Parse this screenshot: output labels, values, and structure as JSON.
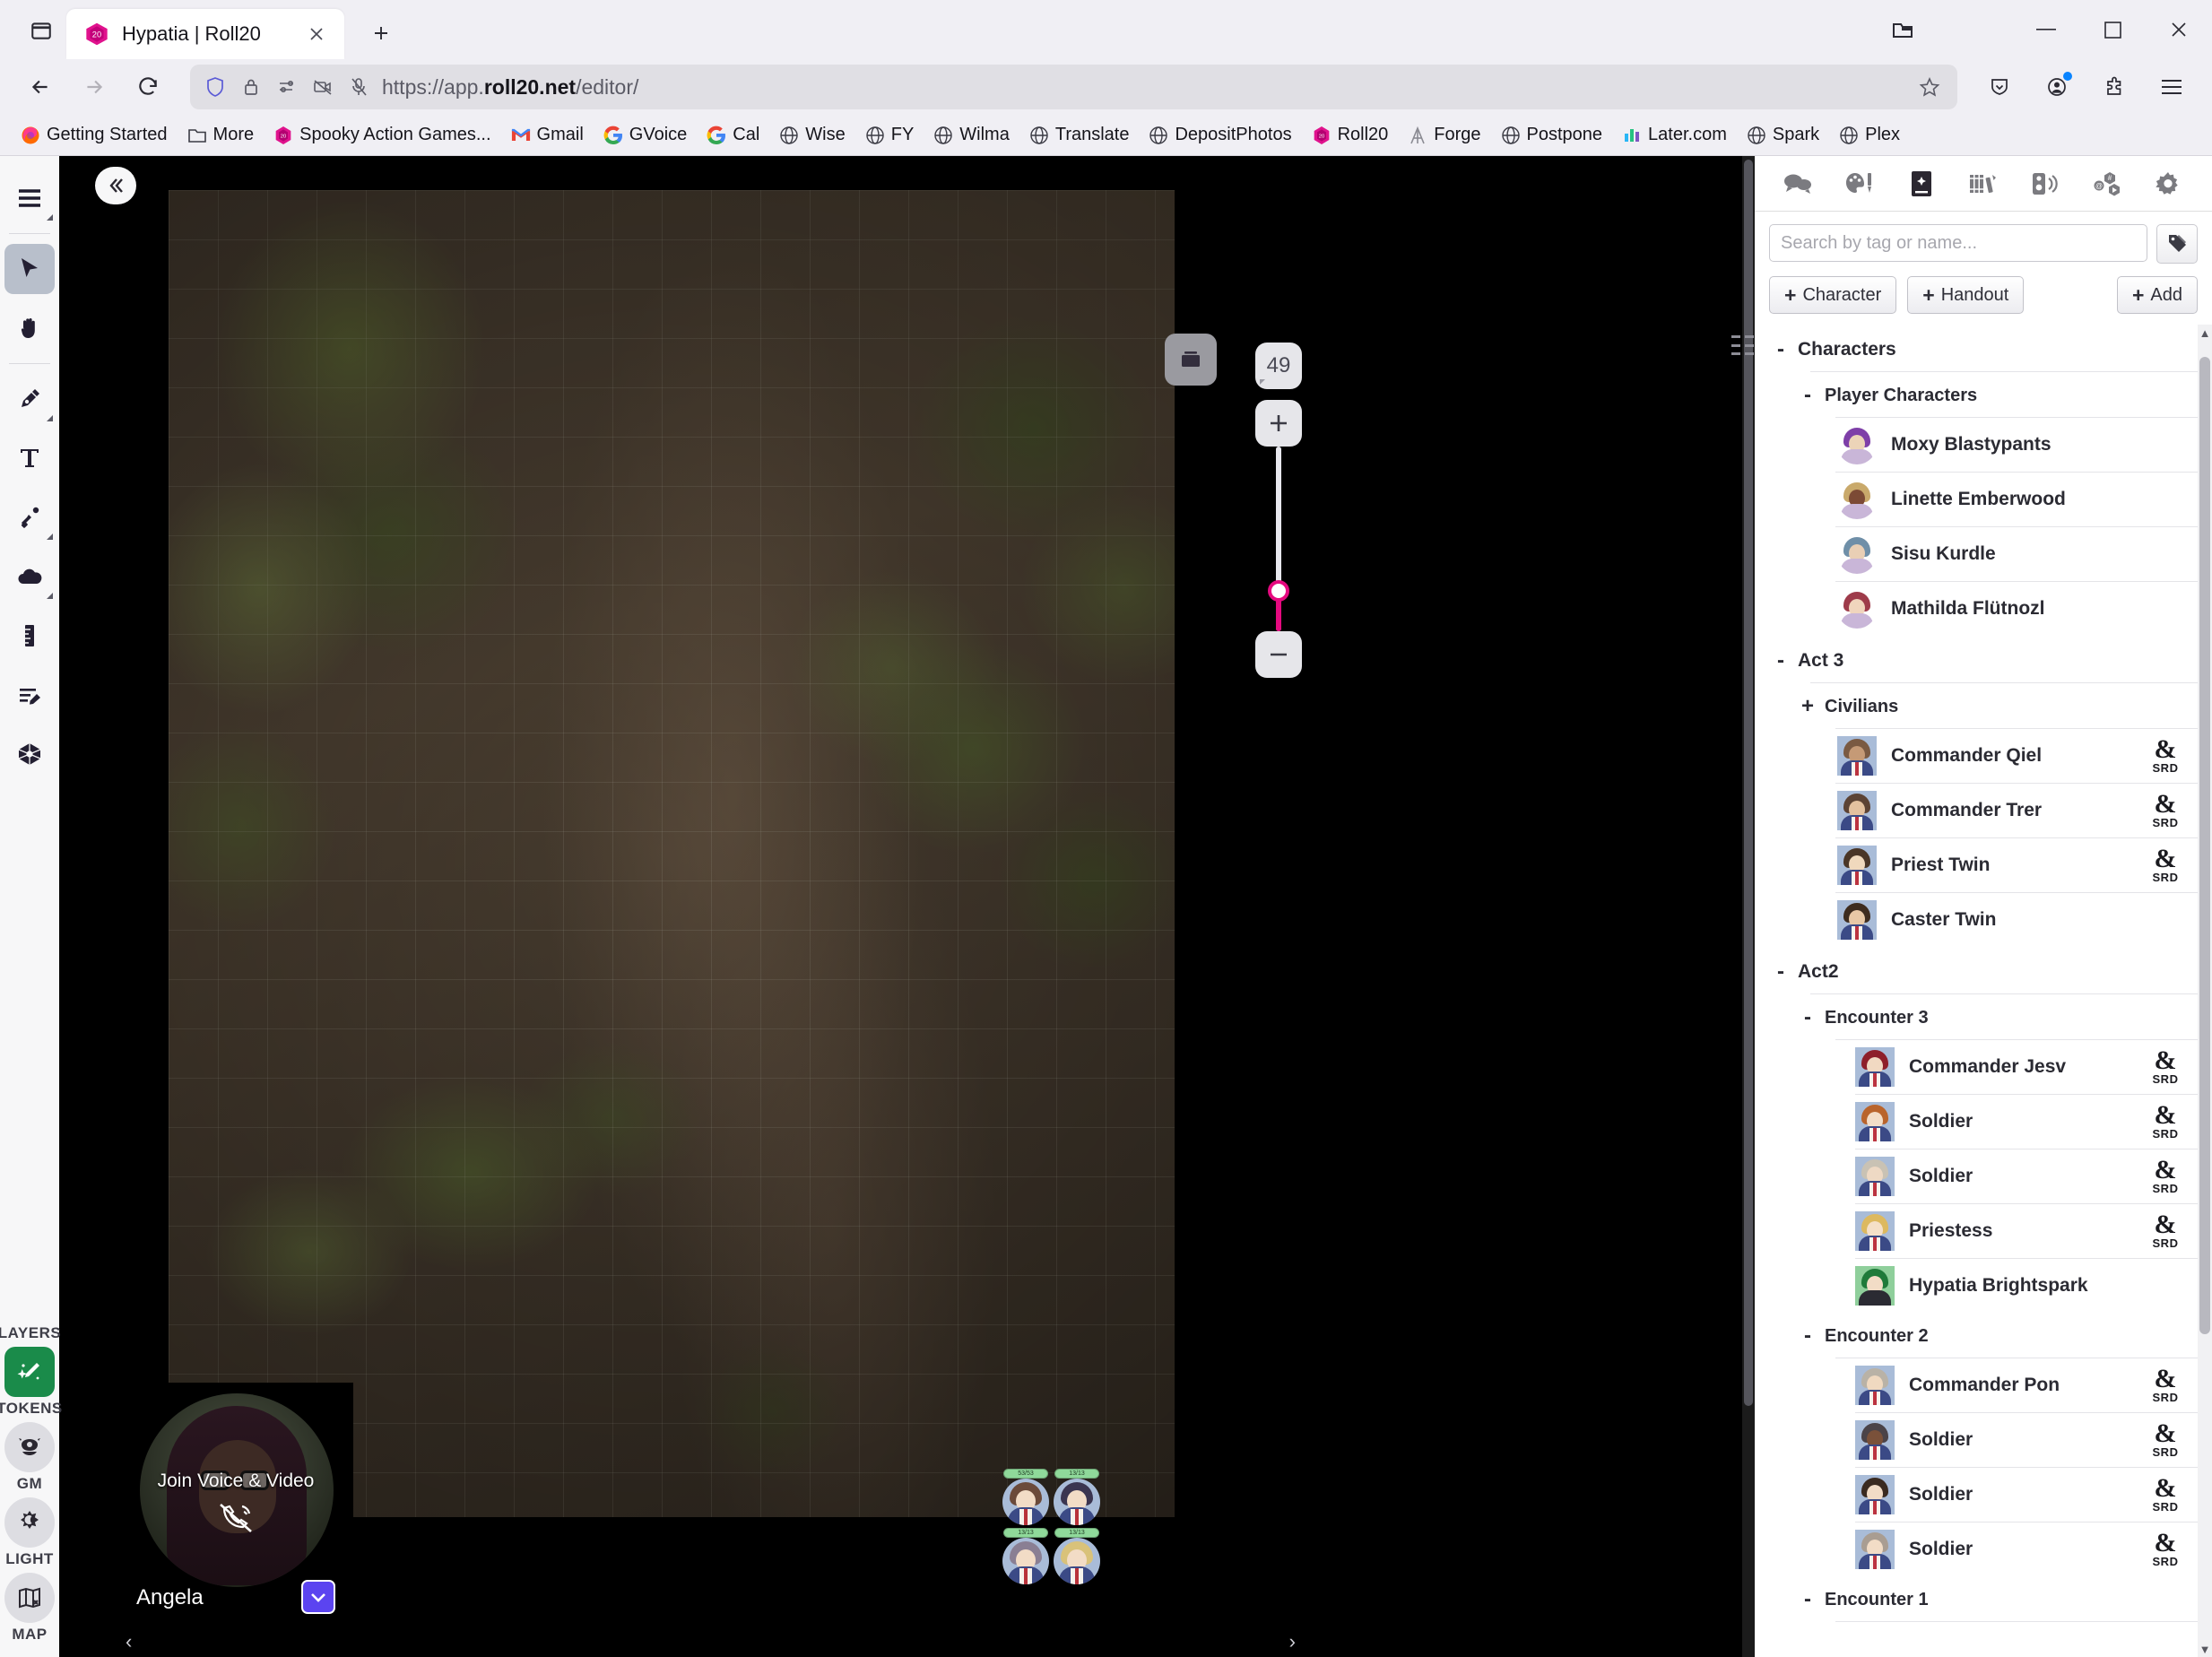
{
  "browser": {
    "tab": {
      "title": "Hypatia | Roll20",
      "favicon": "roll20-d20-icon"
    },
    "url": {
      "scheme": "https://app.",
      "domain": "roll20.net",
      "path": "/editor/"
    },
    "url_full": "https://app.roll20.net/editor/",
    "window_controls": {
      "list_all_tabs": "list-all-tabs",
      "minimize": "—",
      "maximize": "□",
      "close": "✕"
    },
    "bookmarks": [
      {
        "label": "Getting Started",
        "icon": "firefox-icon"
      },
      {
        "label": "More",
        "icon": "folder-icon"
      },
      {
        "label": "Spooky Action Games...",
        "icon": "roll20-d20-icon"
      },
      {
        "label": "Gmail",
        "icon": "gmail-icon"
      },
      {
        "label": "GVoice",
        "icon": "google-icon"
      },
      {
        "label": "Cal",
        "icon": "google-icon"
      },
      {
        "label": "Wise",
        "icon": "globe-icon"
      },
      {
        "label": "FY",
        "icon": "globe-icon"
      },
      {
        "label": "Wilma",
        "icon": "globe-icon"
      },
      {
        "label": "Translate",
        "icon": "globe-icon"
      },
      {
        "label": "DepositPhotos",
        "icon": "globe-icon"
      },
      {
        "label": "Roll20",
        "icon": "roll20-d20-icon"
      },
      {
        "label": "Forge",
        "icon": "forge-icon"
      },
      {
        "label": "Postpone",
        "icon": "globe-icon"
      },
      {
        "label": "Later.com",
        "icon": "later-icon"
      },
      {
        "label": "Spark",
        "icon": "globe-icon"
      },
      {
        "label": "Plex",
        "icon": "globe-icon"
      }
    ]
  },
  "left_toolbar": {
    "collapse_label": "collapse-sidebar",
    "tools": [
      {
        "name": "menu-tool",
        "icon": "hamburger-icon",
        "active": false,
        "has_submenu": true
      },
      {
        "name": "select-tool",
        "icon": "cursor-arrow-icon",
        "active": true,
        "has_submenu": false
      },
      {
        "name": "pan-tool",
        "icon": "hand-icon",
        "active": false,
        "has_submenu": false
      },
      {
        "name": "draw-tool",
        "icon": "pen-icon",
        "active": false,
        "has_submenu": true
      },
      {
        "name": "text-tool",
        "icon": "text-t-icon",
        "active": false,
        "has_submenu": false
      },
      {
        "name": "light-tool",
        "icon": "torch-icon",
        "active": false,
        "has_submenu": true
      },
      {
        "name": "fog-tool",
        "icon": "cloud-icon",
        "active": false,
        "has_submenu": true
      },
      {
        "name": "measure-tool",
        "icon": "ruler-icon",
        "active": false,
        "has_submenu": false
      },
      {
        "name": "initiative-tool",
        "icon": "turn-order-icon",
        "active": false,
        "has_submenu": false
      },
      {
        "name": "dice-tool",
        "icon": "d20-icon",
        "active": false,
        "has_submenu": false
      }
    ],
    "layers": {
      "title": "LAYERS",
      "items": [
        {
          "label": "TOKENS",
          "icon": "sword-sparkle-icon",
          "active": true
        },
        {
          "label": "GM",
          "icon": "gm-mask-icon",
          "active": false
        },
        {
          "label": "LIGHT",
          "icon": "sun-moon-icon",
          "active": false
        },
        {
          "label": "MAP",
          "icon": "map-x-icon",
          "active": false
        }
      ]
    }
  },
  "canvas": {
    "map_settings_icon": "page-toolbox-icon",
    "zoom": {
      "level": "49",
      "zoom_in": "+",
      "zoom_out": "−",
      "slider_percent": 22,
      "accent": "#e5097f"
    },
    "tokens": [
      {
        "name": "token-commander",
        "hp": "53/53",
        "hair": "#6b4a3a",
        "bar_color": "#8fd99a"
      },
      {
        "name": "token-soldier-1",
        "hp": "13/13",
        "hair": "#3b3550",
        "bar_color": "#8fd99a"
      },
      {
        "name": "token-soldier-2",
        "hp": "13/13",
        "hair": "#8a7f93",
        "bar_color": "#8fd99a"
      },
      {
        "name": "token-soldier-3",
        "hp": "13/13",
        "hair": "#d9c27a",
        "bar_color": "#8fd99a"
      }
    ]
  },
  "video": {
    "join_label": "Join Voice & Video",
    "user_name": "Angela",
    "phone_icon": "phone-off-icon",
    "toggle_icon": "chevron-down-icon"
  },
  "right_panel": {
    "tabs": [
      {
        "name": "chat",
        "icon": "chat-bubbles-icon",
        "active": false
      },
      {
        "name": "art-library",
        "icon": "palette-brush-icon",
        "active": false
      },
      {
        "name": "journal",
        "icon": "journal-book-icon",
        "active": true
      },
      {
        "name": "compendium",
        "icon": "compendium-books-icon",
        "active": false
      },
      {
        "name": "jukebox",
        "icon": "speaker-waves-icon",
        "active": false
      },
      {
        "name": "mods",
        "icon": "mods-hex-icon",
        "active": false
      },
      {
        "name": "settings",
        "icon": "gear-icon",
        "active": false
      }
    ],
    "search": {
      "placeholder": "Search by tag or name...",
      "value": "",
      "tag_button_icon": "tag-icon"
    },
    "actions": {
      "character": "Character",
      "handout": "Handout",
      "add": "Add",
      "plus": "+"
    },
    "tree": [
      {
        "type": "group",
        "level": 0,
        "label": "Characters",
        "toggle": "-"
      },
      {
        "type": "group",
        "level": 1,
        "label": "Player Characters",
        "toggle": "-"
      },
      {
        "type": "item",
        "level": 2,
        "label": "Moxy Blastypants",
        "srd": false,
        "avatar": "circle",
        "hair": "#7e3fa8",
        "skin": "#ecd4b8"
      },
      {
        "type": "item",
        "level": 2,
        "label": "Linette Emberwood",
        "srd": false,
        "avatar": "circle",
        "hair": "#c9a96b",
        "skin": "#7c4a35"
      },
      {
        "type": "item",
        "level": 2,
        "label": "Sisu Kurdle",
        "srd": false,
        "avatar": "circle",
        "hair": "#6f8fa8",
        "skin": "#e9cfb5"
      },
      {
        "type": "item",
        "level": 2,
        "label": "Mathilda Flütnozl",
        "srd": false,
        "avatar": "circle",
        "hair": "#9e3b4a",
        "skin": "#f0d5bd"
      },
      {
        "type": "group",
        "level": 0,
        "label": "Act 3",
        "toggle": "-"
      },
      {
        "type": "group",
        "level": 1,
        "label": "Civilians",
        "toggle": "+"
      },
      {
        "type": "item",
        "level": 2,
        "label": "Commander Qiel",
        "srd": true,
        "avatar": "square",
        "hair": "#7a5a42",
        "skin": "#c59a76"
      },
      {
        "type": "item",
        "level": 2,
        "label": "Commander Trer",
        "srd": true,
        "avatar": "square",
        "hair": "#5c4334",
        "skin": "#e3c19f"
      },
      {
        "type": "item",
        "level": 2,
        "label": "Priest Twin",
        "srd": true,
        "avatar": "square",
        "hair": "#4a3627",
        "skin": "#f0d9bd"
      },
      {
        "type": "item",
        "level": 2,
        "label": "Caster Twin",
        "srd": false,
        "avatar": "square",
        "hair": "#3e2c1f",
        "skin": "#e8c8a6"
      },
      {
        "type": "group",
        "level": 0,
        "label": "Act2",
        "toggle": "-"
      },
      {
        "type": "group",
        "level": 1,
        "label": "Encounter 3",
        "toggle": "-"
      },
      {
        "type": "item",
        "level": 3,
        "label": "Commander Jesv",
        "srd": true,
        "avatar": "square",
        "hair": "#8e1f2a",
        "skin": "#f1d9c2"
      },
      {
        "type": "item",
        "level": 3,
        "label": "Soldier",
        "srd": true,
        "avatar": "square",
        "hair": "#b9642c",
        "skin": "#f3ddc7"
      },
      {
        "type": "item",
        "level": 3,
        "label": "Soldier",
        "srd": true,
        "avatar": "square",
        "hair": "#c9c2b4",
        "skin": "#eed9c4"
      },
      {
        "type": "item",
        "level": 3,
        "label": "Priestess",
        "srd": true,
        "avatar": "square",
        "hair": "#ddb95f",
        "skin": "#f5e0c8"
      },
      {
        "type": "item",
        "level": 3,
        "label": "Hypatia Brightspark",
        "srd": false,
        "avatar": "green",
        "hair": "#1f7a3a",
        "skin": "#f2dcc6"
      },
      {
        "type": "group",
        "level": 1,
        "label": "Encounter 2",
        "toggle": "-"
      },
      {
        "type": "item",
        "level": 3,
        "label": "Commander Pon",
        "srd": true,
        "avatar": "square",
        "hair": "#b9b2a6",
        "skin": "#f0d9c0"
      },
      {
        "type": "item",
        "level": 3,
        "label": "Soldier",
        "srd": true,
        "avatar": "square",
        "hair": "#4b4348",
        "skin": "#7a513a"
      },
      {
        "type": "item",
        "level": 3,
        "label": "Soldier",
        "srd": true,
        "avatar": "square",
        "hair": "#3a2a20",
        "skin": "#f2dcc6"
      },
      {
        "type": "item",
        "level": 3,
        "label": "Soldier",
        "srd": true,
        "avatar": "square",
        "hair": "#a99d92",
        "skin": "#f2dcc6"
      },
      {
        "type": "group",
        "level": 1,
        "label": "Encounter 1",
        "toggle": "-"
      }
    ],
    "srd_label": "SRD",
    "srd_glyph": "&"
  }
}
